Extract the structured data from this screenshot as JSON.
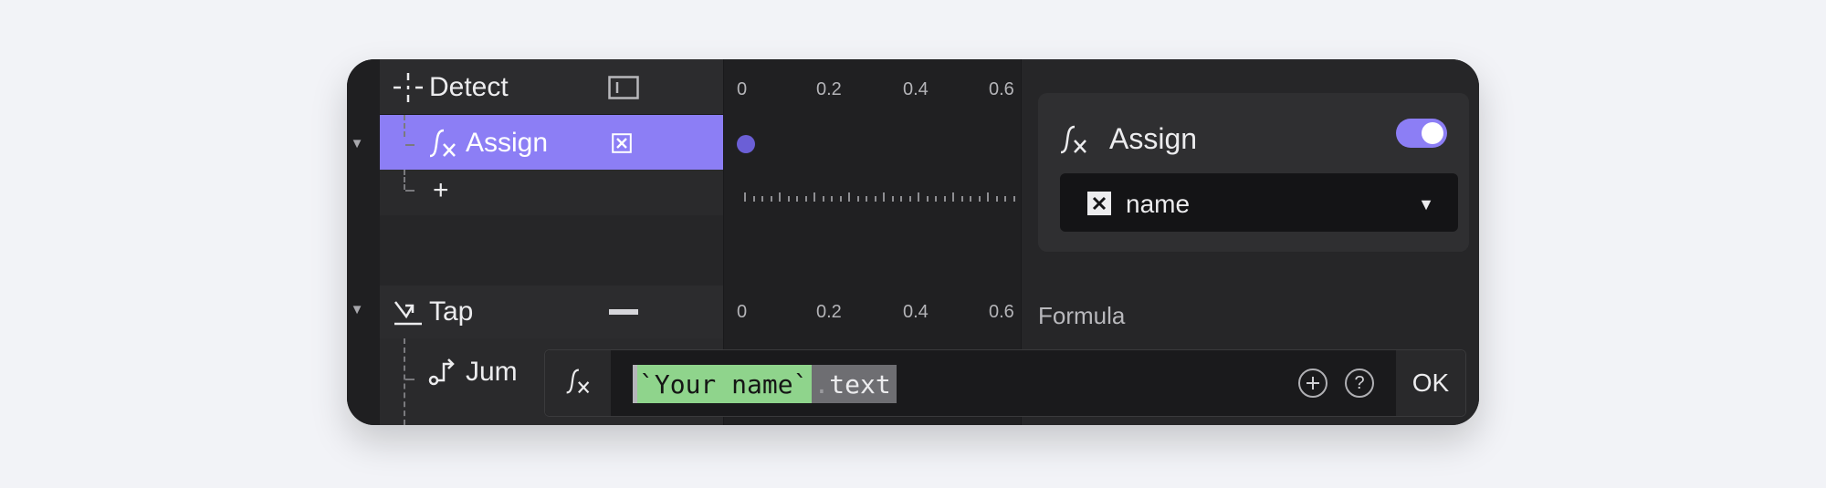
{
  "layers": {
    "detect": {
      "label": "Detect",
      "icon": "crosshair-icon",
      "action_icon": "frame-icon"
    },
    "assign": {
      "label": "Assign",
      "icon": "fx-icon",
      "action_icon": "variable-icon"
    },
    "add": {
      "label": "+"
    },
    "tap": {
      "label": "Tap",
      "icon": "tap-trigger-icon",
      "action_icon": "dash-icon"
    },
    "jump": {
      "label": "Jum",
      "icon": "jump-icon"
    }
  },
  "timeline": {
    "ruler_top": [
      "0",
      "0.2",
      "0.4",
      "0.6"
    ],
    "ruler_bottom": [
      "0",
      "0.2",
      "0.4",
      "0.6"
    ],
    "keyframe_color": "#6b5fd6"
  },
  "inspector": {
    "title": "Assign",
    "toggle_on": true,
    "variable_value": "name",
    "section_label": "Formula"
  },
  "formula_bar": {
    "fx_icon": "fx-icon",
    "token_string": "`Your name`",
    "token_dot": ".",
    "token_prop": "text",
    "add_icon": "plus-circle-icon",
    "help_label": "?",
    "ok_label": "OK"
  },
  "colors": {
    "accent": "#8c7ef5",
    "string_token": "#8fd48c"
  }
}
